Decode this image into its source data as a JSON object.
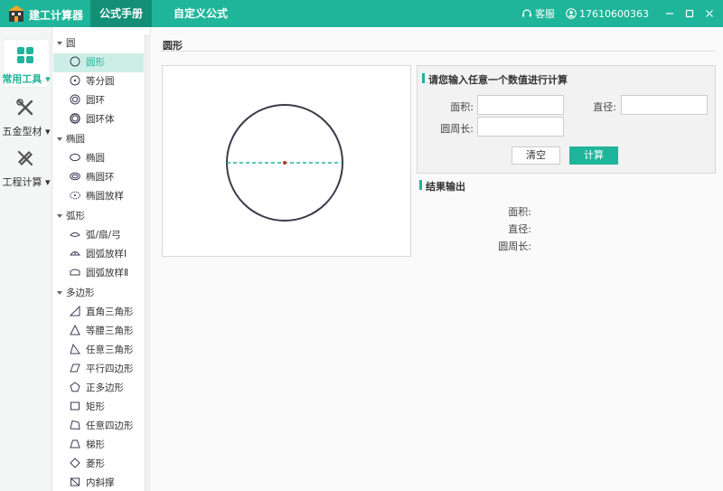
{
  "titlebar": {
    "app_name": "建工计算器",
    "tabs": [
      {
        "label": "公式手册",
        "active": true
      },
      {
        "label": "自定义公式",
        "active": false
      }
    ],
    "service_label": "客服",
    "phone": "17610600363",
    "accent_color": "#1fb59a"
  },
  "rail": {
    "items": [
      {
        "label": "常用工具 ▾",
        "icon": "grid-icon",
        "active": true
      },
      {
        "label": "五金型材 ▾",
        "icon": "wrench-icon",
        "active": false
      },
      {
        "label": "工程计算 ▾",
        "icon": "ruler-pencil-icon",
        "active": false
      }
    ]
  },
  "tree": {
    "groups": [
      {
        "label": "圆",
        "items": [
          {
            "label": "圆形",
            "icon": "circle-icon",
            "selected": true
          },
          {
            "label": "等分圆",
            "icon": "divided-circle-icon"
          },
          {
            "label": "圆环",
            "icon": "ring-icon"
          },
          {
            "label": "圆环体",
            "icon": "torus-icon"
          }
        ]
      },
      {
        "label": "椭圆",
        "items": [
          {
            "label": "椭圆",
            "icon": "ellipse-icon"
          },
          {
            "label": "椭圆环",
            "icon": "ellipse-ring-icon"
          },
          {
            "label": "椭圆放样",
            "icon": "ellipse-loft-icon"
          }
        ]
      },
      {
        "label": "弧形",
        "items": [
          {
            "label": "弧/扇/弓",
            "icon": "arc-icon"
          },
          {
            "label": "圆弧放样Ⅰ",
            "icon": "arc-loft-1-icon"
          },
          {
            "label": "圆弧放样Ⅱ",
            "icon": "arc-loft-2-icon"
          }
        ]
      },
      {
        "label": "多边形",
        "items": [
          {
            "label": "直角三角形",
            "icon": "right-triangle-icon"
          },
          {
            "label": "等腰三角形",
            "icon": "isosceles-triangle-icon"
          },
          {
            "label": "任意三角形",
            "icon": "triangle-icon"
          },
          {
            "label": "平行四边形",
            "icon": "parallelogram-icon"
          },
          {
            "label": "正多边形",
            "icon": "pentagon-icon"
          },
          {
            "label": "矩形",
            "icon": "rectangle-icon"
          },
          {
            "label": "任意四边形",
            "icon": "quadrilateral-icon"
          },
          {
            "label": "梯形",
            "icon": "trapezoid-icon"
          },
          {
            "label": "菱形",
            "icon": "rhombus-icon"
          },
          {
            "label": "内斜撑",
            "icon": "brace-icon"
          }
        ]
      }
    ]
  },
  "main": {
    "title": "圆形",
    "input_section": {
      "title": "请您输入任意一个数值进行计算",
      "fields": [
        {
          "label": "面积:",
          "value": ""
        },
        {
          "label": "直径:",
          "value": ""
        },
        {
          "label": "圆周长:",
          "value": ""
        }
      ],
      "clear_label": "清空",
      "calc_label": "计算"
    },
    "result_section": {
      "title": "结果输出",
      "rows": [
        {
          "label": "面积:",
          "value": ""
        },
        {
          "label": "直径:",
          "value": ""
        },
        {
          "label": "圆周长:",
          "value": ""
        }
      ]
    }
  }
}
